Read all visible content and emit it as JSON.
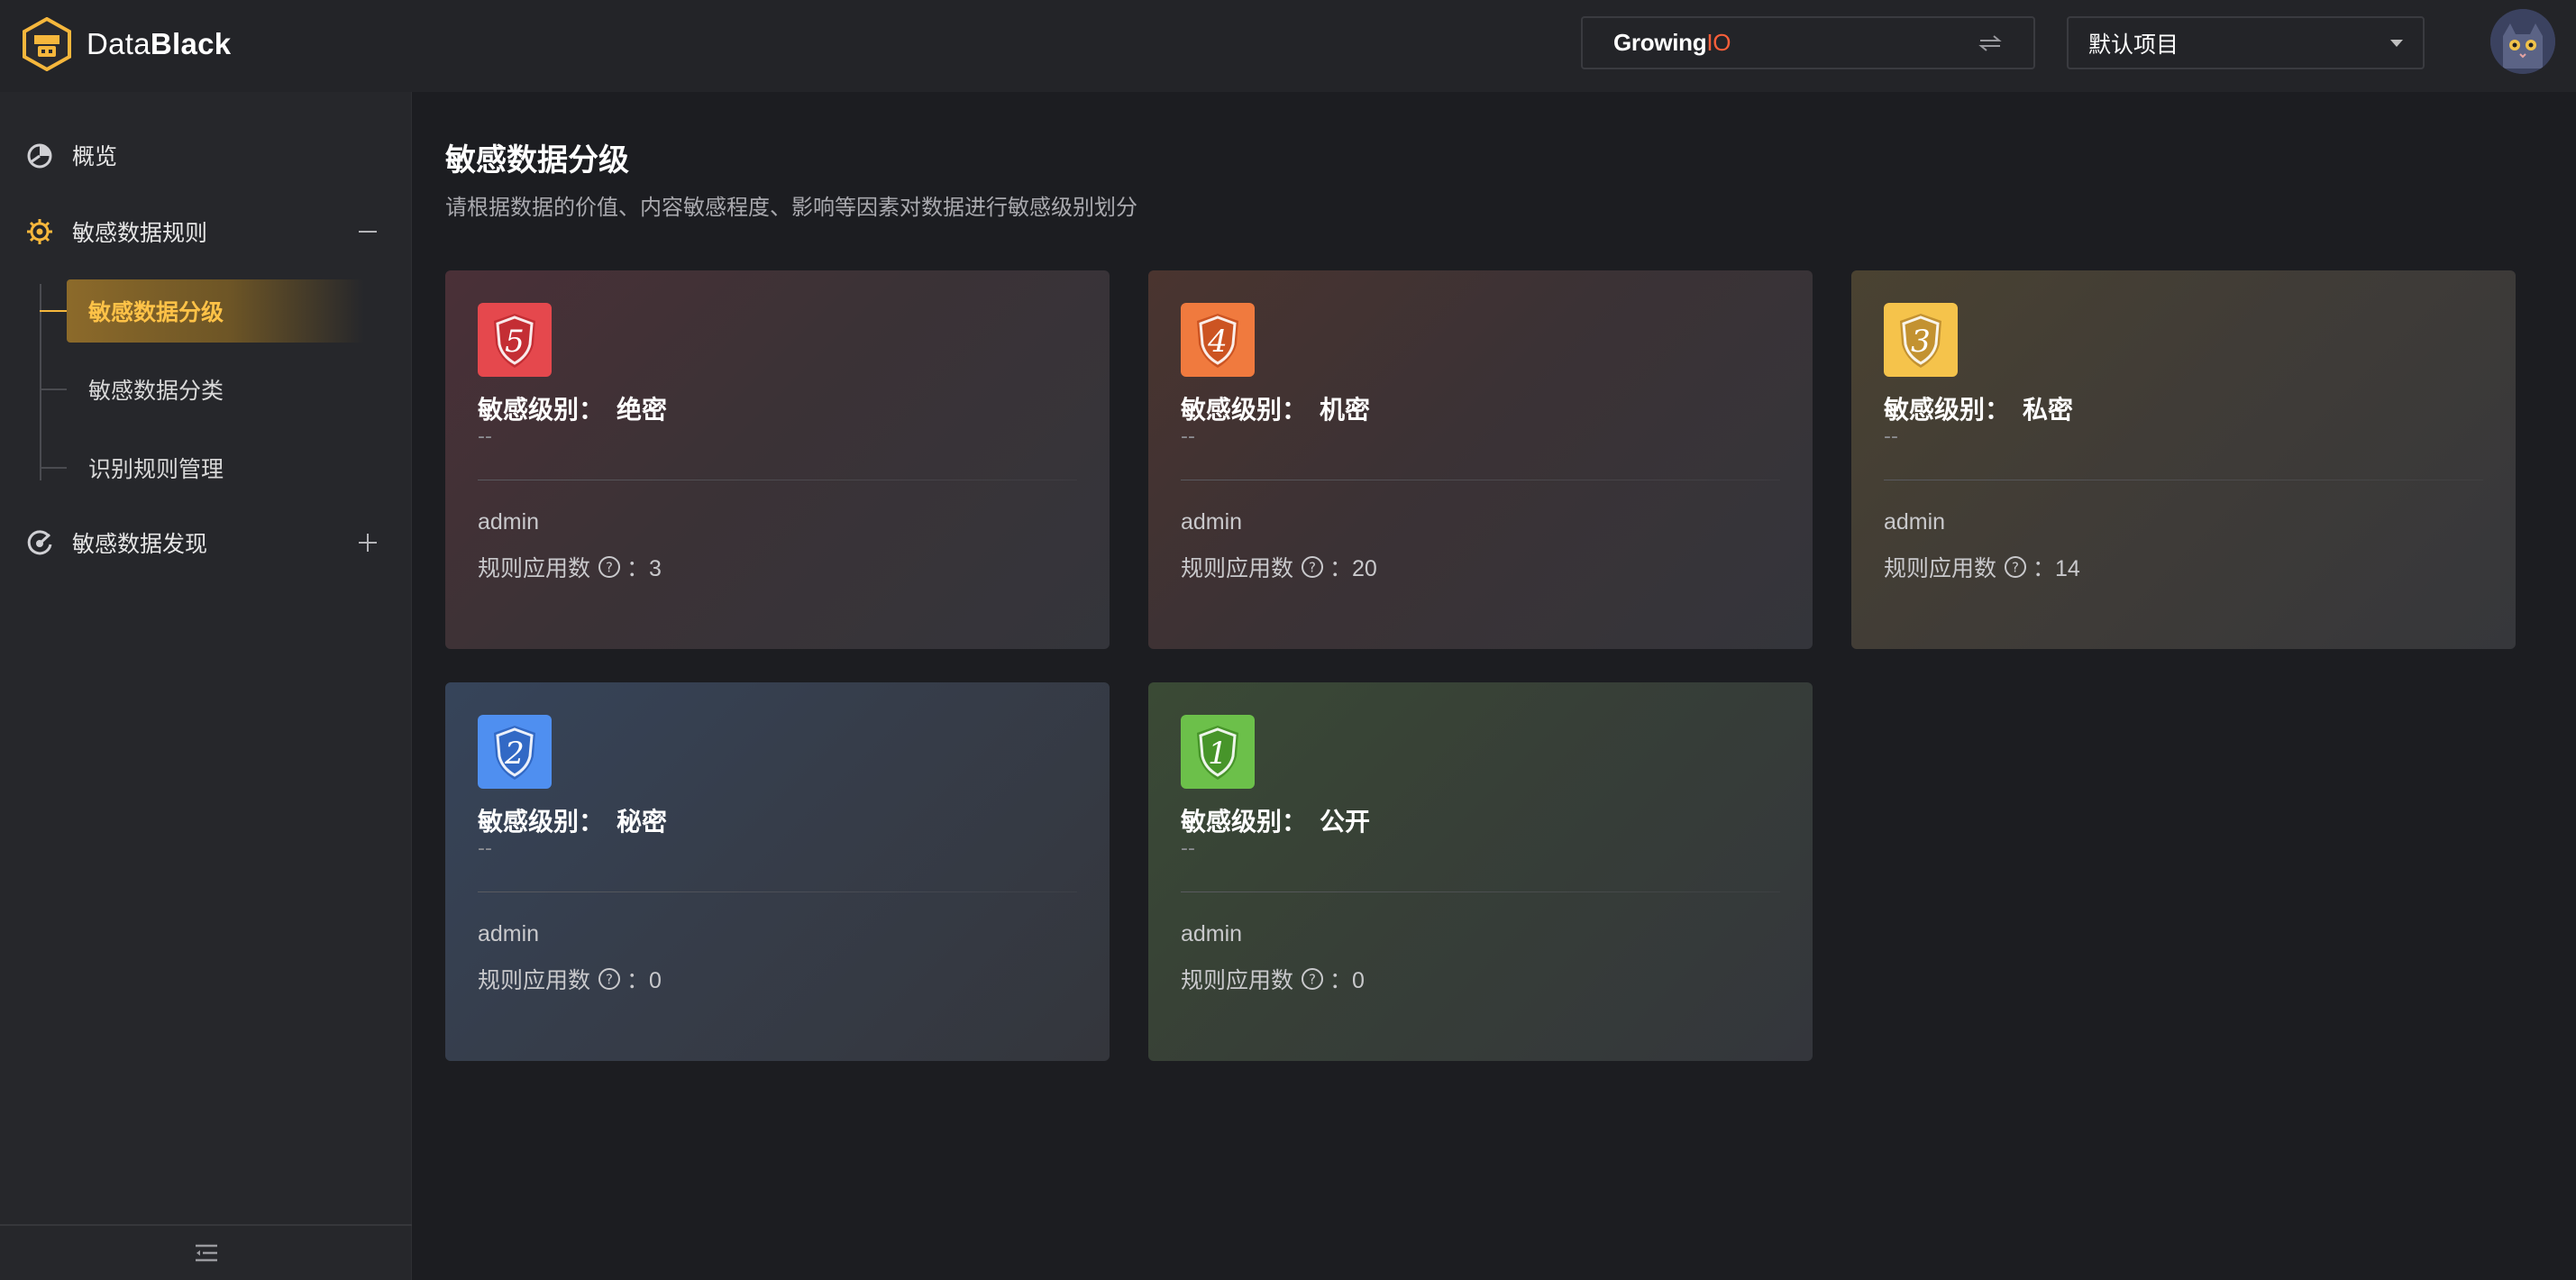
{
  "header": {
    "logo_text_a": "Data",
    "logo_text_b": "Black",
    "org_name_a": "Growing",
    "org_name_b": "IO",
    "project_label": "默认项目"
  },
  "sidebar": {
    "items": [
      {
        "label": "概览",
        "icon": "pie-chart-icon"
      },
      {
        "label": "敏感数据规则",
        "icon": "gear-icon",
        "toggle": "minus"
      },
      {
        "label": "敏感数据发现",
        "icon": "radar-icon",
        "toggle": "plus"
      }
    ],
    "sub_items": [
      {
        "label": "敏感数据分级",
        "active": true
      },
      {
        "label": "敏感数据分类",
        "active": false
      },
      {
        "label": "识别规则管理",
        "active": false
      }
    ]
  },
  "page": {
    "title": "敏感数据分级",
    "subtitle": "请根据数据的价值、内容敏感程度、影响等因素对数据进行敏感级别划分"
  },
  "cards": [
    {
      "level": "5",
      "prefix": "敏感级别：",
      "name": "绝密",
      "desc": "--",
      "owner": "admin",
      "rules_label": "规则应用数",
      "rules_count": "：3",
      "color": "#e5484d"
    },
    {
      "level": "4",
      "prefix": "敏感级别：",
      "name": "机密",
      "desc": "--",
      "owner": "admin",
      "rules_label": "规则应用数",
      "rules_count": "：20",
      "color": "#f07a3e"
    },
    {
      "level": "3",
      "prefix": "敏感级别：",
      "name": "私密",
      "desc": "--",
      "owner": "admin",
      "rules_label": "规则应用数",
      "rules_count": "：14",
      "color": "#f5c34b"
    },
    {
      "level": "2",
      "prefix": "敏感级别：",
      "name": "秘密",
      "desc": "--",
      "owner": "admin",
      "rules_label": "规则应用数",
      "rules_count": "：0",
      "color": "#4f8ff0"
    },
    {
      "level": "1",
      "prefix": "敏感级别：",
      "name": "公开",
      "desc": "--",
      "owner": "admin",
      "rules_label": "规则应用数",
      "rules_count": "：0",
      "color": "#6cc04a"
    }
  ]
}
